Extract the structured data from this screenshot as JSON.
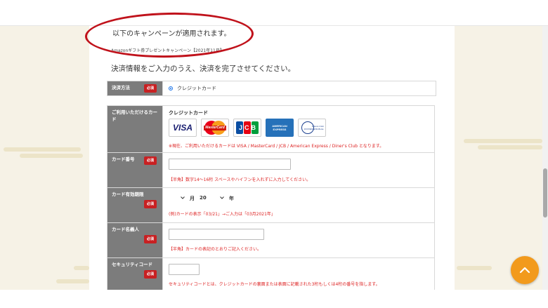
{
  "campaign": {
    "notice": "以下のキャンペーンが適用されます。",
    "name": "Amazonギフト券プレゼントキャンペーン【2021年11月】"
  },
  "instruction": "決済情報をご入力のうえ、決済を完了させてください。",
  "required_badge": "必須",
  "payment": {
    "label": "決済方法",
    "option_label": "クレジットカード",
    "selected": true
  },
  "cards": {
    "label": "ご利用いただけるカード",
    "title": "クレジットカード",
    "logos": [
      "VISA",
      "MasterCard",
      "JCB",
      "AMERICAN EXPRESS",
      "Diners Club INTERNATIONAL"
    ],
    "note": "※現在、ご利用いただけるカードは VISA / MasterCard / JCB / American Express / Diner's Club となります。"
  },
  "card_number": {
    "label": "カード番号",
    "value": "",
    "note": "【半角】数字14～16桁 スペースやハイフンを入れずに入力してください。"
  },
  "expiry": {
    "label": "カード有効期限",
    "month_unit": "月",
    "year_prefix": "20",
    "year_unit": "年",
    "note": "(例)カードの表示「03/21」→ご入力は「03月2021年」"
  },
  "holder": {
    "label": "カード名義人",
    "value": "",
    "note": "【半角】カードの表記のとおりご記入ください。"
  },
  "security": {
    "label": "セキュリティコード",
    "value": "",
    "note": "セキュリティコードとは、クレジットカードの裏面または表面に記載された3桁もしくは4桁の番号を指します。"
  },
  "colors": {
    "label_bg": "#7c7c7c",
    "required": "#c82022",
    "note": "#dd2222",
    "highlight_oval": "#c0121b",
    "scroll_top_button": "#f29a1c",
    "background": "#f6f2e6"
  },
  "icons": {
    "scroll_top": "chevron-up-icon",
    "select_arrow": "chevron-down-icon"
  }
}
